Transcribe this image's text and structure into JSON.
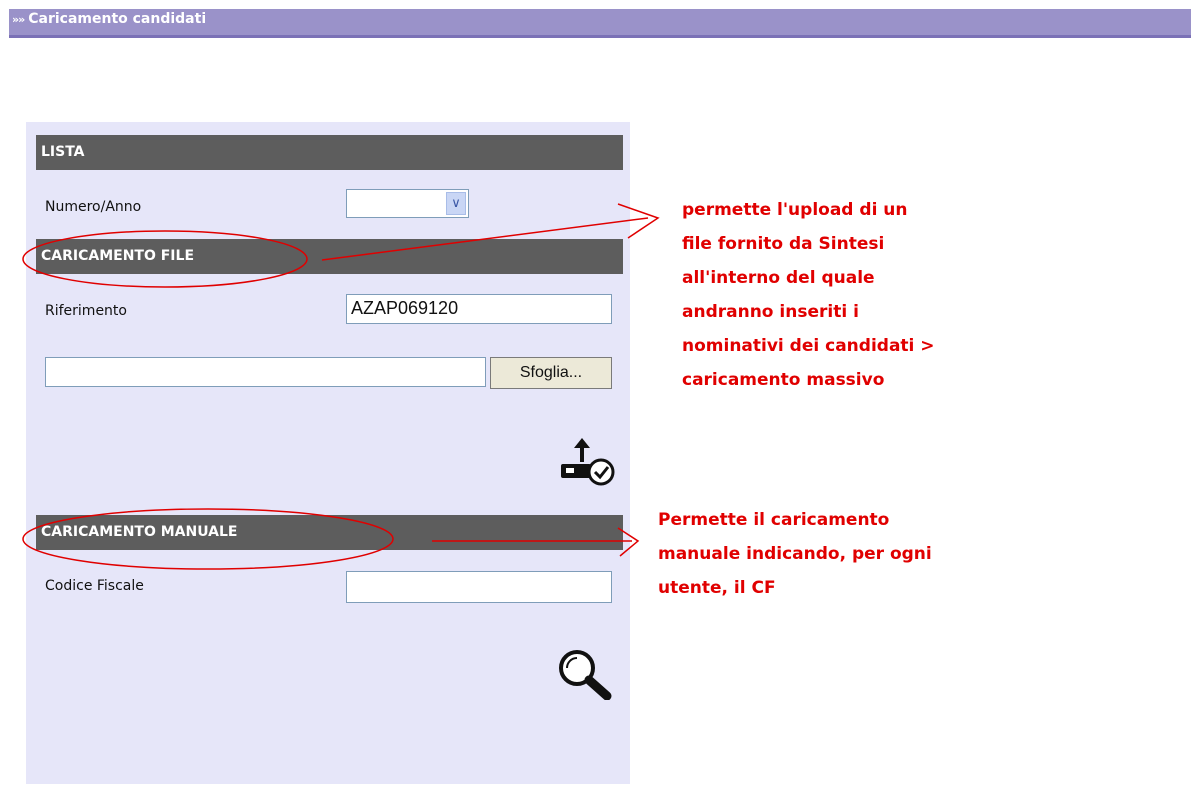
{
  "header": {
    "chevrons": "»»",
    "title": "Caricamento candidati"
  },
  "lista": {
    "heading": "LISTA",
    "numero_anno_label": "Numero/Anno",
    "numero_anno_value": ""
  },
  "file_upload": {
    "heading": "CARICAMENTO FILE",
    "riferimento_label": "Riferimento",
    "riferimento_value": "AZAP069120",
    "file_value": "",
    "browse_label": "Sfoglia..."
  },
  "manual": {
    "heading": "CARICAMENTO MANUALE",
    "codice_fiscale_label": "Codice Fiscale",
    "codice_fiscale_value": ""
  },
  "icons": {
    "upload": "upload-confirm-icon",
    "search": "search-icon"
  },
  "annotations": {
    "note_file": [
      "permette l'upload di un",
      "file fornito da Sintesi",
      "all'interno del quale",
      "andranno inseriti i",
      "nominativi dei candidati >",
      "caricamento massivo"
    ],
    "note_manual": [
      "Permette il caricamento",
      "manuale indicando, per ogni",
      "utente, il CF"
    ],
    "color": "#e00000"
  }
}
